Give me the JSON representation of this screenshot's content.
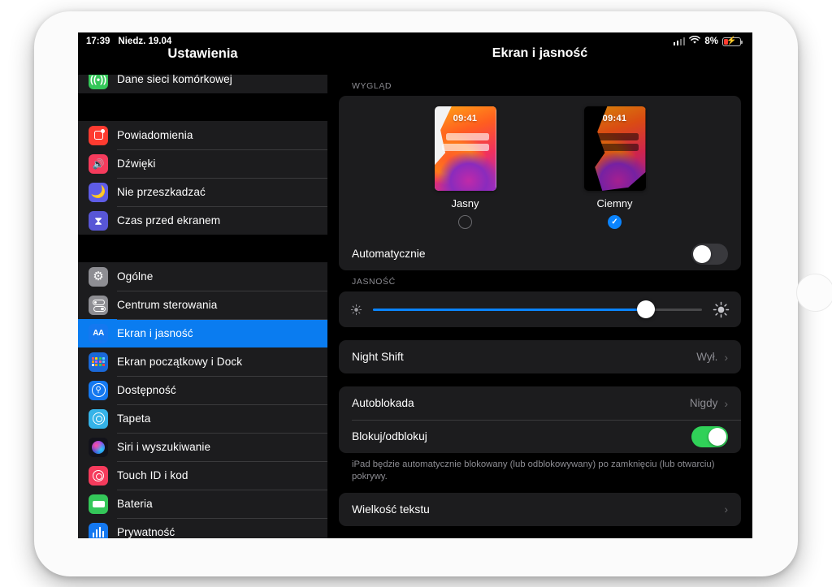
{
  "status_bar": {
    "time": "17:39",
    "date": "Niedz. 19.04",
    "battery_percent": "8%",
    "signal_icon": "cellular-signal-icon",
    "wifi_icon": "wifi-icon",
    "battery_icon": "battery-charging-icon"
  },
  "sidebar": {
    "title": "Ustawienia",
    "groups": [
      {
        "items": [
          {
            "label": "Dane sieci komórkowej",
            "icon": "cellular-icon",
            "selected": false
          }
        ]
      },
      {
        "items": [
          {
            "label": "Powiadomienia",
            "icon": "notifications-icon",
            "selected": false
          },
          {
            "label": "Dźwięki",
            "icon": "sounds-icon",
            "selected": false
          },
          {
            "label": "Nie przeszkadzać",
            "icon": "do-not-disturb-icon",
            "selected": false
          },
          {
            "label": "Czas przed ekranem",
            "icon": "screen-time-icon",
            "selected": false
          }
        ]
      },
      {
        "items": [
          {
            "label": "Ogólne",
            "icon": "gear-icon",
            "selected": false
          },
          {
            "label": "Centrum sterowania",
            "icon": "control-center-icon",
            "selected": false
          },
          {
            "label": "Ekran i jasność",
            "icon": "display-brightness-icon",
            "selected": true
          },
          {
            "label": "Ekran początkowy i Dock",
            "icon": "home-screen-dock-icon",
            "selected": false
          },
          {
            "label": "Dostępność",
            "icon": "accessibility-icon",
            "selected": false
          },
          {
            "label": "Tapeta",
            "icon": "wallpaper-icon",
            "selected": false
          },
          {
            "label": "Siri i wyszukiwanie",
            "icon": "siri-icon",
            "selected": false
          },
          {
            "label": "Touch ID i kod",
            "icon": "touch-id-icon",
            "selected": false
          },
          {
            "label": "Bateria",
            "icon": "battery-icon",
            "selected": false
          },
          {
            "label": "Prywatność",
            "icon": "privacy-icon",
            "selected": false
          }
        ]
      }
    ]
  },
  "detail": {
    "title": "Ekran i jasność",
    "appearance": {
      "section_label": "WYGLĄD",
      "options": [
        {
          "label": "Jasny",
          "thumb_time": "09:41",
          "selected": false
        },
        {
          "label": "Ciemny",
          "thumb_time": "09:41",
          "selected": true
        }
      ],
      "checkmark_glyph": "✓",
      "automatic": {
        "label": "Automatycznie",
        "state": "off"
      }
    },
    "brightness": {
      "section_label": "JASNOŚĆ",
      "value_percent": 83,
      "low_icon": "sun-low-icon",
      "high_icon": "sun-high-icon"
    },
    "night_shift": {
      "label": "Night Shift",
      "value": "Wył.",
      "chevron": "›"
    },
    "autolock_group": {
      "autolock": {
        "label": "Autoblokada",
        "value": "Nigdy",
        "chevron": "›"
      },
      "lock_unlock": {
        "label": "Blokuj/odblokuj",
        "state": "on"
      },
      "footnote": "iPad będzie automatycznie blokowany (lub odblokowywany) po zamknięciu (lub otwarciu) pokrywy."
    },
    "text_size": {
      "label": "Wielkość tekstu",
      "chevron": "›"
    }
  },
  "colors": {
    "accent_blue": "#0a84ff",
    "selected_row_blue": "#0a7cf0",
    "toggle_on_green": "#30d158",
    "card_background": "#1c1c1e",
    "screen_background": "#000000",
    "secondary_text": "#8d8d93"
  }
}
